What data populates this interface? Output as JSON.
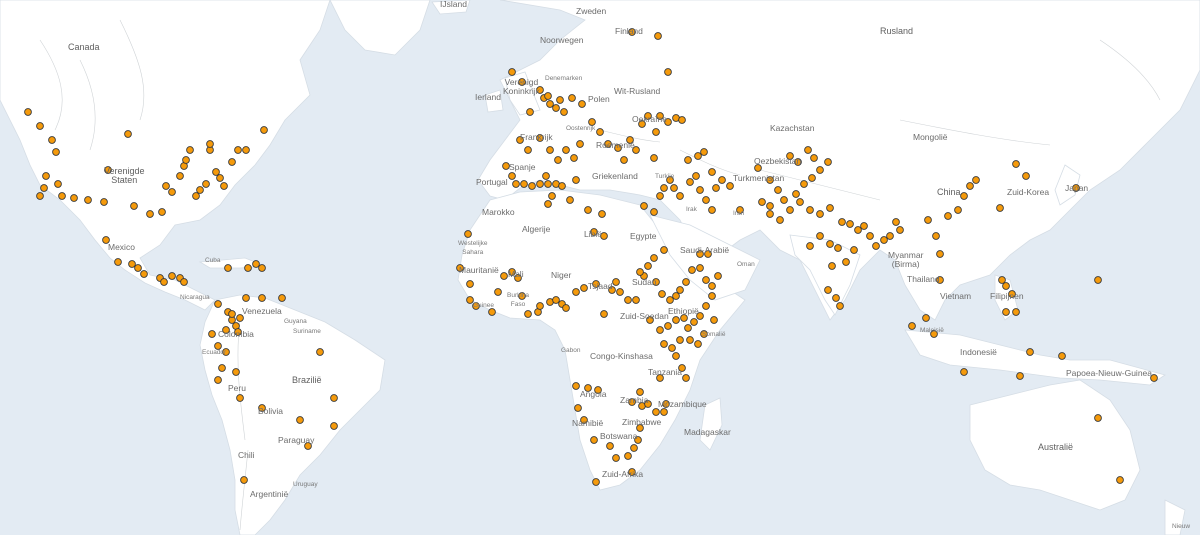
{
  "map": {
    "marker_color": "#f59a0b",
    "marker_stroke": "#3a3a3a",
    "land_color": "#ffffff",
    "water_color": "#e3ebf3",
    "labels": {
      "canada": "Canada",
      "vs": "Verenigde\nStaten",
      "mexico": "Mexico",
      "cuba": "Cuba",
      "nicaragua": "Nicaragua",
      "venezuela": "Venezuela",
      "guyana": "Guyana",
      "suriname": "Suriname",
      "colombia": "Colombia",
      "ecuador": "Ecuador",
      "peru": "Peru",
      "brazilie": "Brazilië",
      "bolivia": "Bolivia",
      "paraguay": "Paraguay",
      "chili": "Chili",
      "uruguay": "Uruguay",
      "argentinie": "Argentinië",
      "ijsland": "IJsland",
      "zweden": "Zweden",
      "noorwegen": "Noorwegen",
      "finland": "Finland",
      "denemarken": "Denemarken",
      "vk": "Verenigd\nKoninkrijk",
      "ierland": "Ierland",
      "polen": "Polen",
      "witrusland": "Wit-Rusland",
      "oekraine": "Oekraïne",
      "frankrijk": "Frankrijk",
      "oostenrijk": "Oostenrijk",
      "roemenie": "Roemenië",
      "spanje": "Spanje",
      "portugal": "Portugal",
      "griekenland": "Griekenland",
      "marokko": "Marokko",
      "algerije": "Algerije",
      "libie": "Libië",
      "egypte": "Egypte",
      "westsahara": "Westelijke\nSahara",
      "mauritanie": "Mauritanië",
      "mali": "Mali",
      "niger": "Niger",
      "burkina": "Burkina\nFaso",
      "guinee": "Guinee",
      "tsjaad": "Tsjaad",
      "soedan": "Sudan",
      "zuidsoedan": "Zuid-Soedan",
      "ethiopie": "Ethiopië",
      "somalie": "Somalië",
      "gabon": "Gabon",
      "congo": "Congo-Kinshasa",
      "tanzania": "Tanzania",
      "angola": "Angola",
      "zambia": "Zambia",
      "mozambique": "Mozambique",
      "zimbabwe": "Zimbabwe",
      "namibie": "Namibië",
      "botswana": "Botswana",
      "madagaskar": "Madagaskar",
      "zuidafrika": "Zuid-Afrika",
      "saudi": "Saudi-Arabië",
      "oman": "Oman",
      "irak": "Irak",
      "iran": "Iran",
      "turkije": "Turkije",
      "rusland": "Rusland",
      "kazachstan": "Kazachstan",
      "mongolie": "Mongolië",
      "oezbekistan": "Oezbekistan",
      "turkmenistan": "Turkmenistan",
      "china": "China",
      "zuidkorea": "Zuid-Korea",
      "japan": "Japan",
      "myanmar": "Myanmar\n(Birma)",
      "thailand": "Thailand",
      "vietnam": "Vietnam",
      "filipijnen": "Filipijnen",
      "maleisie": "Maleisië",
      "indonesie": "Indonesië",
      "png": "Papoea-Nieuw-Guinea",
      "australie": "Australië",
      "nieuw": "Nieuw"
    }
  }
}
